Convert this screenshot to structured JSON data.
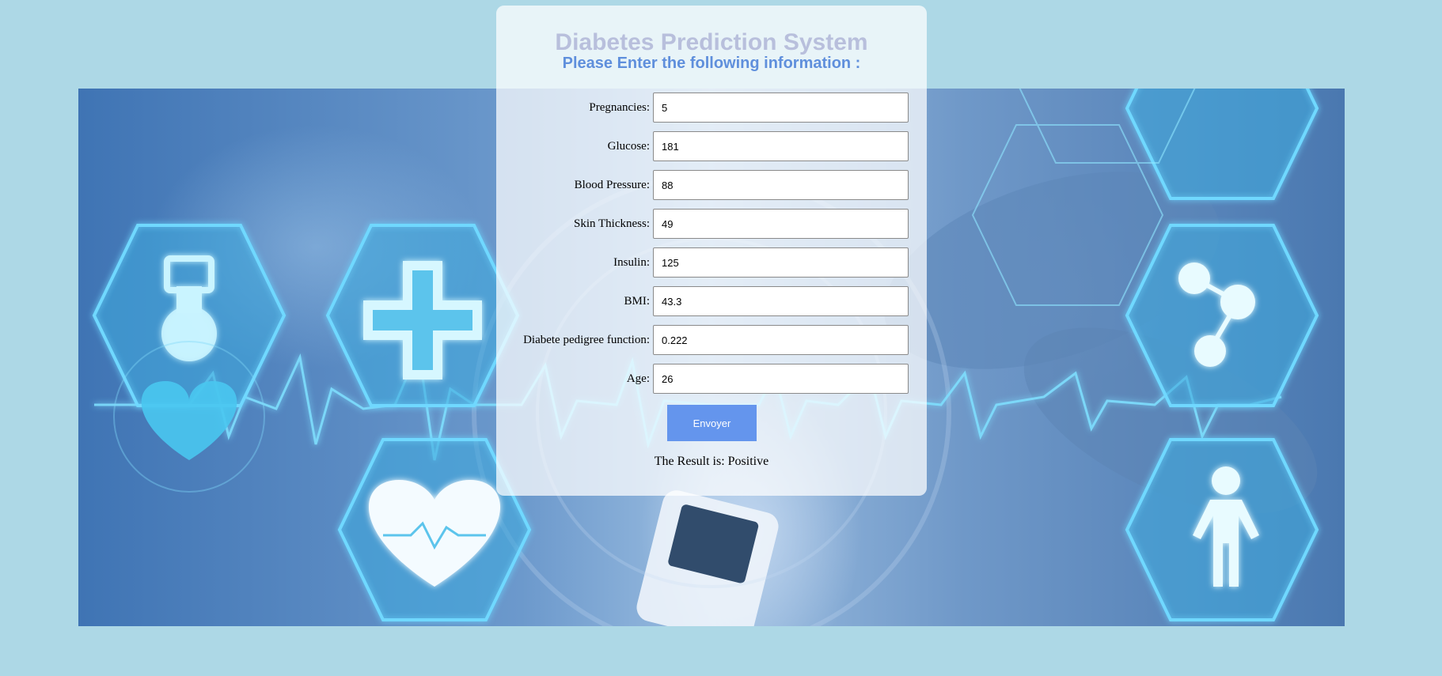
{
  "page": {
    "title": "Diabetes Prediction System",
    "subtitle": "Please Enter the following information :"
  },
  "form": {
    "fields": [
      {
        "label": "Pregnancies:",
        "value": "5"
      },
      {
        "label": "Glucose:",
        "value": "181"
      },
      {
        "label": "Blood Pressure:",
        "value": "88"
      },
      {
        "label": "Skin Thickness:",
        "value": "49"
      },
      {
        "label": "Insulin:",
        "value": "125"
      },
      {
        "label": "BMI:",
        "value": "43.3"
      },
      {
        "label": "Diabete pedigree function:",
        "value": "0.222"
      },
      {
        "label": "Age:",
        "value": "26"
      }
    ],
    "submit_label": "Envoyer",
    "result_text": "The Result is: Positive"
  },
  "background": {
    "icons": [
      "flask-icon",
      "medical-cross-icon",
      "heart-icon",
      "heartbeat-icon",
      "share-nodes-icon",
      "person-icon"
    ]
  },
  "colors": {
    "page_bg": "#add8e6",
    "button_bg": "#6495ed",
    "subtitle": "#5f8fdc",
    "title": "#b8bfdc"
  }
}
